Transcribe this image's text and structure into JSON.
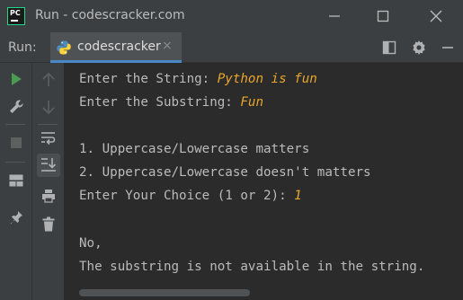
{
  "window": {
    "title": "Run - codescracker.com",
    "app_icon_text": "PC",
    "controls": [
      "minimize-icon",
      "maximize-icon",
      "close-icon"
    ]
  },
  "run_panel": {
    "label": "Run:",
    "tab": {
      "label": "codescracker",
      "close_symbol": "×",
      "icon": "python-icon"
    },
    "toolbar_icons": [
      "layout-icon",
      "gear-icon",
      "minimize-panel-icon"
    ],
    "left_toolbar_1": [
      "run-icon",
      "wrench-icon",
      "stop-icon",
      "layout-icon",
      "pin-icon"
    ],
    "left_toolbar_2": [
      "arrow-up-icon",
      "arrow-down-icon",
      "soft-wrap-icon",
      "scroll-to-end-icon",
      "print-icon",
      "trash-icon"
    ]
  },
  "console": {
    "lines": [
      {
        "prompt": "Enter the String: ",
        "input": "Python is fun"
      },
      {
        "prompt": "Enter the Substring: ",
        "input": "Fun"
      },
      {
        "text": ""
      },
      {
        "text": "1. Uppercase/Lowercase matters"
      },
      {
        "text": "2. Uppercase/Lowercase doesn't matters"
      },
      {
        "prompt": "Enter Your Choice (1 or 2): ",
        "input": "1"
      },
      {
        "text": ""
      },
      {
        "text": "No,"
      },
      {
        "text": "The substring is not available in the string."
      }
    ]
  },
  "colors": {
    "background": "#2b2b2b",
    "panel": "#3c3f41",
    "text": "#bbbbbb",
    "input_text": "#e8a62d",
    "run_green": "#499c54",
    "tab_underline": "#4a88c7"
  }
}
